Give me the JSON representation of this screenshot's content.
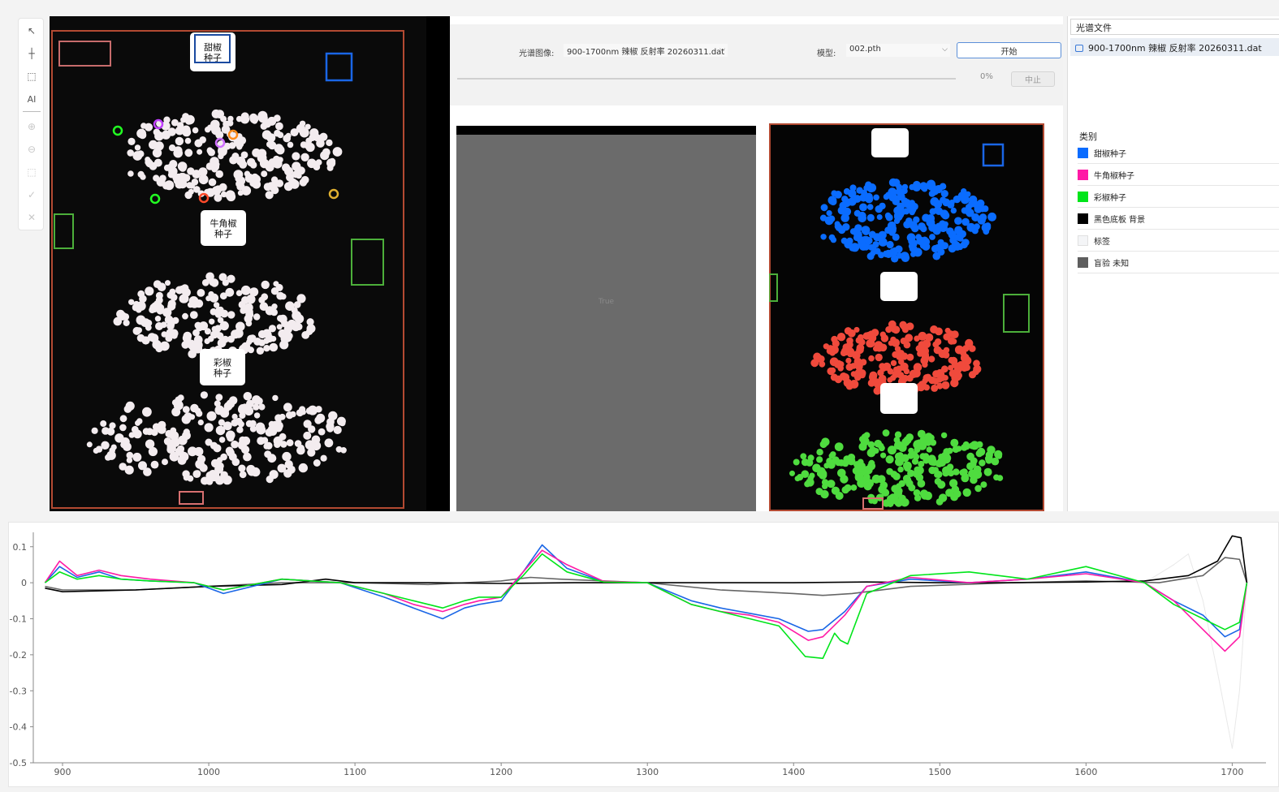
{
  "toolbar": {
    "tools": [
      {
        "name": "pointer-icon",
        "glyph": "↖",
        "enabled": true
      },
      {
        "name": "crosshair-icon",
        "glyph": "┼",
        "enabled": true
      },
      {
        "name": "rect-select-icon",
        "glyph": "⬚",
        "enabled": true
      },
      {
        "name": "ai-icon",
        "glyph": "AI",
        "enabled": true
      },
      {
        "name": "add-icon",
        "glyph": "⊕",
        "enabled": false
      },
      {
        "name": "remove-icon",
        "glyph": "⊖",
        "enabled": false
      },
      {
        "name": "crop-icon",
        "glyph": "⬚",
        "enabled": false
      },
      {
        "name": "confirm-icon",
        "glyph": "✓",
        "enabled": false
      },
      {
        "name": "cancel-icon",
        "glyph": "✕",
        "enabled": false
      }
    ]
  },
  "left_image": {
    "labels": [
      {
        "line1": "甜椒",
        "line2": "种子"
      },
      {
        "line1": "牛角椒",
        "line2": "种子"
      },
      {
        "line1": "彩椒",
        "line2": "种子"
      }
    ]
  },
  "controls": {
    "image_label": "光谱图像:",
    "image_value": "900-1700nm 辣椒 反射率 20260311.dat",
    "model_label": "模型:",
    "model_value": "002.pth",
    "start_button": "开始",
    "progress_text": "0%",
    "progress": 0,
    "stop_button": "中止"
  },
  "gray_view": {
    "text": "True"
  },
  "right_panel": {
    "file_header": "光谱文件",
    "file_item": "900-1700nm 辣椒 反射率 20260311.dat",
    "class_header": "类别",
    "classes": [
      {
        "label": "甜椒种子",
        "color": "#0a6cff"
      },
      {
        "label": "牛角椒种子",
        "color": "#ff1aa6"
      },
      {
        "label": "彩椒种子",
        "color": "#00e51a"
      },
      {
        "label": "黑色底板 背景",
        "color": "#000000"
      },
      {
        "label": "标签",
        "color": "#f4f5f7"
      },
      {
        "label": "盲验 未知",
        "color": "#5e5e5e"
      }
    ]
  },
  "chart_data": {
    "type": "line",
    "xlim": [
      880,
      1712
    ],
    "ylim": [
      -0.5,
      0.14
    ],
    "x_ticks": [
      900,
      1000,
      1100,
      1200,
      1300,
      1400,
      1500,
      1600,
      1700
    ],
    "y_ticks": [
      0.1,
      0,
      -0.1,
      -0.2,
      -0.3,
      -0.4,
      -0.5
    ],
    "y_tick_labels": [
      "0.1",
      "0",
      "-0.1",
      "-0.2",
      "-0.3",
      "-0.4",
      "-0.5"
    ],
    "grid": false,
    "series": [
      {
        "color": "#1a66e6",
        "x": [
          888,
          898,
          910,
          925,
          940,
          960,
          990,
          1010,
          1050,
          1090,
          1120,
          1140,
          1160,
          1175,
          1185,
          1200,
          1215,
          1228,
          1245,
          1270,
          1300,
          1330,
          1350,
          1370,
          1390,
          1410,
          1420,
          1435,
          1450,
          1480,
          1520,
          1560,
          1600,
          1640,
          1660,
          1680,
          1695,
          1705,
          1710
        ],
        "y": [
          0,
          0.045,
          0.015,
          0.03,
          0.01,
          0.005,
          0.0,
          -0.03,
          0.01,
          0,
          -0.04,
          -0.07,
          -0.1,
          -0.07,
          -0.06,
          -0.05,
          0.03,
          0.105,
          0.04,
          0.003,
          0.0,
          -0.05,
          -0.07,
          -0.085,
          -0.1,
          -0.135,
          -0.13,
          -0.08,
          -0.01,
          0.01,
          0,
          0.01,
          0.03,
          0.0,
          -0.05,
          -0.09,
          -0.15,
          -0.13,
          0
        ]
      },
      {
        "color": "#ff1aa6",
        "x": [
          888,
          898,
          910,
          925,
          940,
          960,
          990,
          1010,
          1050,
          1090,
          1120,
          1140,
          1160,
          1175,
          1185,
          1200,
          1215,
          1228,
          1245,
          1270,
          1300,
          1330,
          1350,
          1370,
          1390,
          1410,
          1420,
          1435,
          1450,
          1480,
          1520,
          1560,
          1600,
          1640,
          1660,
          1680,
          1695,
          1705,
          1710
        ],
        "y": [
          0,
          0.06,
          0.02,
          0.035,
          0.02,
          0.01,
          0.0,
          -0.02,
          0.01,
          0,
          -0.03,
          -0.06,
          -0.08,
          -0.06,
          -0.05,
          -0.04,
          0.03,
          0.09,
          0.05,
          0.004,
          0.0,
          -0.06,
          -0.08,
          -0.09,
          -0.11,
          -0.16,
          -0.15,
          -0.09,
          -0.01,
          0.015,
          0,
          0.01,
          0.025,
          0.0,
          -0.05,
          -0.13,
          -0.19,
          -0.15,
          0
        ]
      },
      {
        "color": "#00e51a",
        "x": [
          888,
          898,
          910,
          925,
          940,
          960,
          990,
          1010,
          1050,
          1090,
          1120,
          1140,
          1160,
          1175,
          1185,
          1200,
          1215,
          1228,
          1245,
          1270,
          1300,
          1330,
          1350,
          1370,
          1390,
          1408,
          1420,
          1428,
          1432,
          1437,
          1450,
          1480,
          1520,
          1560,
          1600,
          1640,
          1660,
          1680,
          1695,
          1705,
          1710
        ],
        "y": [
          0,
          0.03,
          0.01,
          0.02,
          0.01,
          0.005,
          0.0,
          -0.02,
          0.01,
          0,
          -0.03,
          -0.05,
          -0.07,
          -0.05,
          -0.04,
          -0.04,
          0.02,
          0.08,
          0.03,
          0.002,
          0.0,
          -0.06,
          -0.08,
          -0.1,
          -0.12,
          -0.205,
          -0.21,
          -0.14,
          -0.16,
          -0.17,
          -0.03,
          0.02,
          0.03,
          0.01,
          0.045,
          0.0,
          -0.06,
          -0.1,
          -0.13,
          -0.11,
          0
        ]
      },
      {
        "color": "#666666",
        "x": [
          888,
          900,
          950,
          1000,
          1050,
          1100,
          1150,
          1200,
          1220,
          1240,
          1300,
          1350,
          1400,
          1420,
          1440,
          1480,
          1550,
          1600,
          1650,
          1680,
          1695,
          1705,
          1710
        ],
        "y": [
          -0.01,
          -0.02,
          -0.02,
          -0.01,
          0,
          0,
          -0.005,
          0.005,
          0.015,
          0.01,
          0,
          -0.02,
          -0.03,
          -0.035,
          -0.03,
          -0.01,
          0,
          0.005,
          0.0,
          0.02,
          0.07,
          0.065,
          0
        ]
      },
      {
        "color": "#000000",
        "x": [
          888,
          900,
          950,
          1000,
          1050,
          1080,
          1100,
          1150,
          1200,
          1250,
          1300,
          1350,
          1400,
          1450,
          1500,
          1550,
          1600,
          1640,
          1670,
          1690,
          1700,
          1706,
          1710
        ],
        "y": [
          -0.015,
          -0.025,
          -0.02,
          -0.01,
          -0.005,
          0.01,
          0,
          0,
          -0.002,
          0,
          0,
          0,
          0,
          0.002,
          0,
          0,
          0.002,
          0.005,
          0.02,
          0.06,
          0.13,
          0.125,
          0
        ]
      },
      {
        "color": "#e8e8e8",
        "x": [
          1640,
          1660,
          1670,
          1680,
          1690,
          1700,
          1705,
          1710
        ],
        "y": [
          0,
          0.05,
          0.08,
          -0.05,
          -0.25,
          -0.46,
          -0.3,
          0
        ]
      }
    ]
  }
}
